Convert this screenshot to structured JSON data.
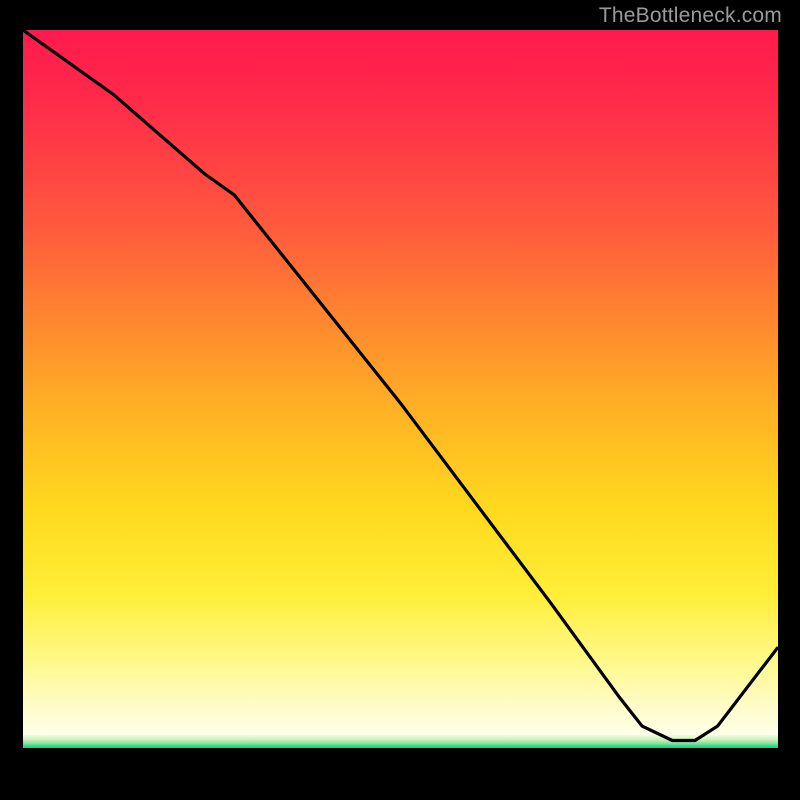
{
  "attribution": "TheBottleneck.com",
  "bottom_label": "",
  "chart_data": {
    "type": "line",
    "title": "",
    "xlabel": "",
    "ylabel": "",
    "xlim": [
      0,
      100
    ],
    "ylim": [
      0,
      100
    ],
    "grid": false,
    "series": [
      {
        "name": "curve",
        "x": [
          0,
          12,
          24,
          28,
          50,
          70,
          79,
          82,
          86,
          89,
          92,
          100
        ],
        "values": [
          100,
          91,
          80,
          77,
          48,
          20,
          7,
          3,
          1,
          1,
          3,
          14
        ]
      }
    ],
    "gradient_bands": [
      "red",
      "orange",
      "yellow",
      "pale-yellow",
      "green"
    ],
    "valley_x_range": [
      82,
      90
    ]
  },
  "colors": {
    "background": "#000000",
    "gradient_top": "#ff1a4d",
    "gradient_mid": "#ffd91e",
    "gradient_bottom": "#fefee8",
    "green_band": "#18cf86",
    "curve": "#000000",
    "attribution_text": "#9a9a9a",
    "bottom_label": "#b01919"
  }
}
